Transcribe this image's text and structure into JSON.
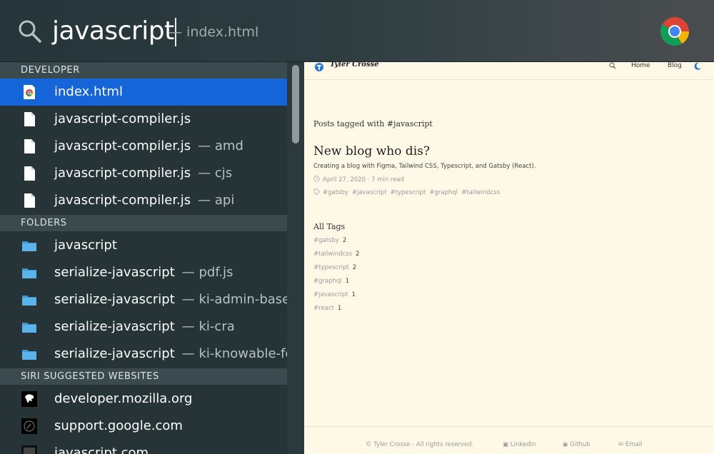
{
  "search": {
    "query": "javascript",
    "hint": "— index.html"
  },
  "sections": {
    "developer": "DEVELOPER",
    "folders": "FOLDERS",
    "siri": "SIRI SUGGESTED WEBSITES"
  },
  "developer_items": [
    {
      "label": "index.html",
      "sub": ""
    },
    {
      "label": "javascript-compiler.js",
      "sub": ""
    },
    {
      "label": "javascript-compiler.js",
      "sub": "— amd"
    },
    {
      "label": "javascript-compiler.js",
      "sub": "— cjs"
    },
    {
      "label": "javascript-compiler.js",
      "sub": "— api"
    }
  ],
  "folder_items": [
    {
      "label": "javascript",
      "sub": ""
    },
    {
      "label": "serialize-javascript",
      "sub": "— pdf.js"
    },
    {
      "label": "serialize-javascript",
      "sub": "— ki-admin-base"
    },
    {
      "label": "serialize-javascript",
      "sub": "— ki-cra"
    },
    {
      "label": "serialize-javascript",
      "sub": "— ki-knowable-fe"
    }
  ],
  "siri_items": [
    {
      "label": "developer.mozilla.org",
      "icon": "mozilla-icon"
    },
    {
      "label": "support.google.com",
      "icon": "google-support-icon"
    },
    {
      "label": "javascript.com",
      "icon": "javascript-site-icon"
    }
  ],
  "preview": {
    "brand": "Tyler Crosse",
    "nav": {
      "home": "Home",
      "blog": "Blog"
    },
    "tag_title": "Posts tagged with #javascript",
    "post_title": "New blog who dis?",
    "post_desc": "Creating a blog with Figma, Tailwind CSS, Typescript, and Gatsby (React).",
    "post_meta": "April 27, 2020 · 7 min read",
    "post_tags": [
      "#gatsby",
      "#javascript",
      "#typescript",
      "#graphql",
      "#tailwindcss"
    ],
    "all_tags_title": "All Tags",
    "all_tags": [
      {
        "tag": "#gatsby",
        "count": "2"
      },
      {
        "tag": "#tailwindcss",
        "count": "2"
      },
      {
        "tag": "#typescript",
        "count": "2"
      },
      {
        "tag": "#graphql",
        "count": "1"
      },
      {
        "tag": "#javascript",
        "count": "1"
      },
      {
        "tag": "#react",
        "count": "1"
      }
    ],
    "footer": {
      "copyright": "© Tyler Crosse - All rights reserved.",
      "linkedin": "LinkedIn",
      "github": "Github",
      "email": "Email"
    }
  },
  "colors": {
    "selection": "#1565d8",
    "folder": "#4aa3df",
    "preview_bg": "#fef8e7"
  }
}
